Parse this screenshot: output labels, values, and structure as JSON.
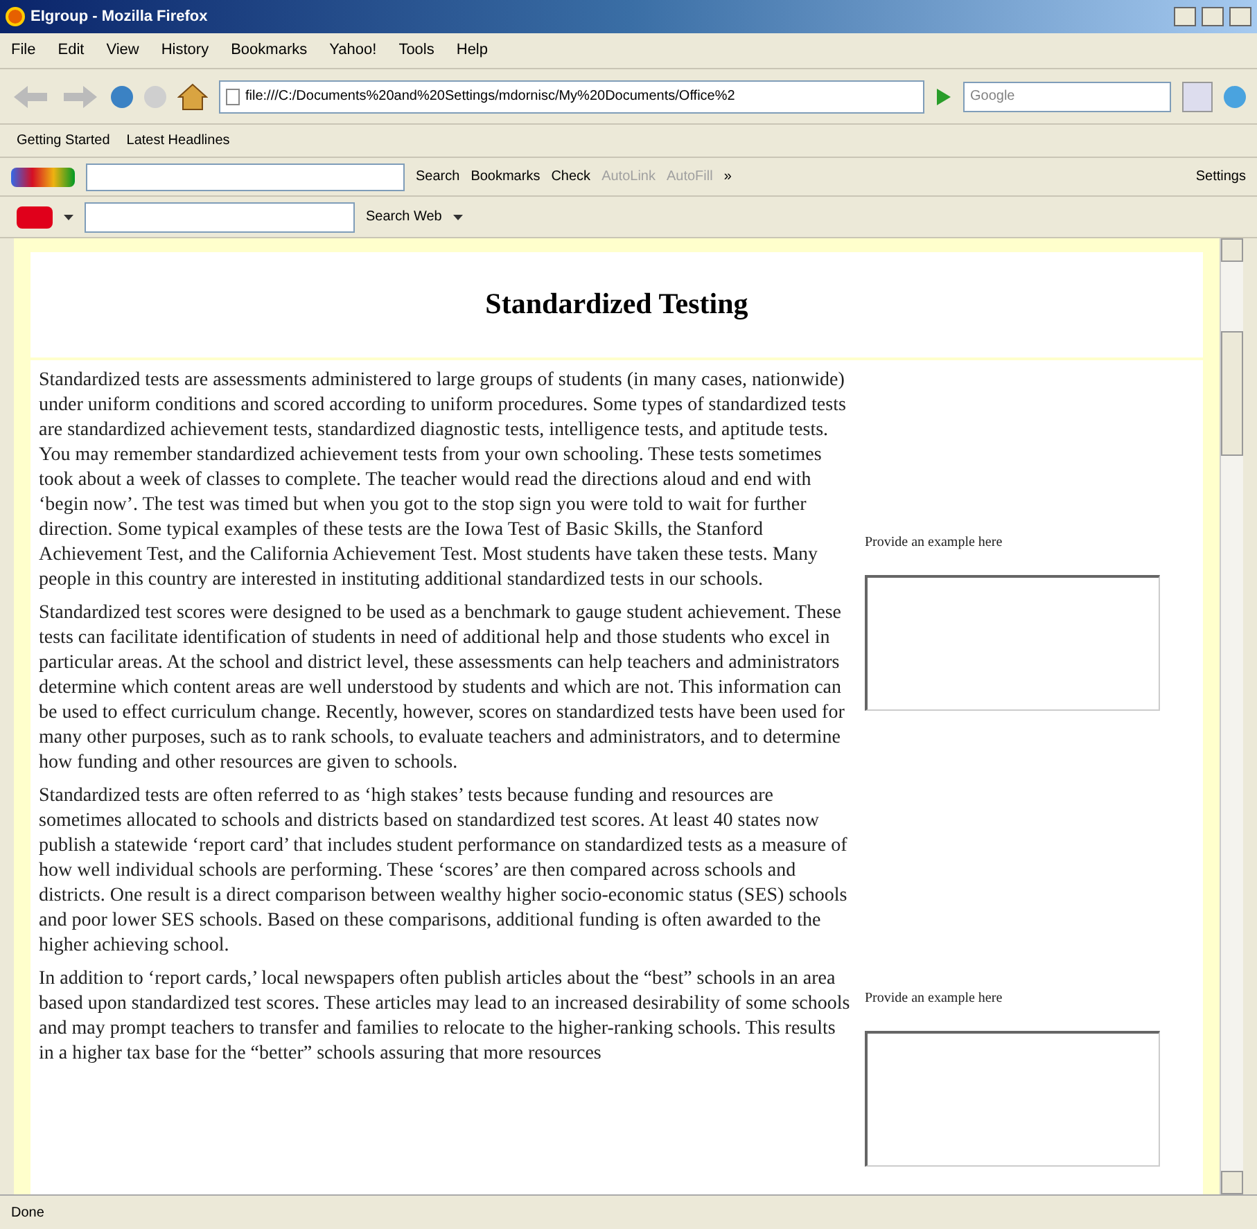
{
  "window": {
    "title": "EIgroup - Mozilla Firefox"
  },
  "menu": [
    "File",
    "Edit",
    "View",
    "History",
    "Bookmarks",
    "Yahoo!",
    "Tools",
    "Help"
  ],
  "navigation": {
    "url": "file:///C:/Documents%20and%20Settings/mdornisc/My%20Documents/Office%2",
    "search_placeholder": "Google"
  },
  "bookmarks_toolbar": [
    "Getting Started",
    "Latest Headlines"
  ],
  "google_toolbar": [
    {
      "label": "Search",
      "disabled": false
    },
    {
      "label": "Bookmarks",
      "disabled": false
    },
    {
      "label": "Check",
      "disabled": false
    },
    {
      "label": "AutoLink",
      "disabled": true
    },
    {
      "label": "AutoFill",
      "disabled": true
    },
    {
      "label": "»",
      "disabled": false
    },
    {
      "label": "Settings",
      "disabled": false
    }
  ],
  "yahoo_toolbar": {
    "search_label": "Search Web"
  },
  "page": {
    "title": "Standardized Testing",
    "paragraphs": [
      "Standardized tests are assessments administered to large groups of students (in many cases, nationwide) under uniform conditions and scored according to uniform procedures.  Some types of standardized tests are standardized achievement tests, standardized diagnostic tests, intelligence tests, and aptitude tests.  You may remember standardized achievement tests from your own schooling.  These tests sometimes took about a week of classes to complete.  The teacher would read the directions aloud and end with ‘begin now’.  The test was timed but when you got to the stop sign you were told to wait for further direction.  Some typical examples of these tests are the Iowa Test of Basic Skills, the Stanford Achievement Test, and the California Achievement Test. Most students have taken these tests.  Many people in this country are interested in instituting additional standardized tests in our schools.",
      "Standardized test scores were designed to be used as a benchmark to gauge student achievement. These tests can facilitate identification of students in need of additional help and those students who excel in particular areas.  At the school and district level, these assessments can help teachers and administrators determine which content areas are well understood by students and which are not.  This information can be used to effect curriculum change.  Recently, however, scores on standardized tests have been used for many other purposes, such as to rank schools, to evaluate teachers and administrators, and to determine how funding and other resources are given to schools.",
      "Standardized tests are often referred to as ‘high stakes’ tests because funding and resources are sometimes allocated to schools and districts based on standardized test scores. At least 40 states now publish a statewide ‘report card’ that includes student performance on standardized tests as a measure of how well individual schools are performing.  These ‘scores’ are then compared across schools and districts.  One result is a direct comparison between wealthy higher socio-economic status (SES) schools and poor lower SES schools. Based on these comparisons, additional funding is often awarded to the higher achieving school.",
      "In addition to ‘report cards,’ local newspapers often publish articles about the “best” schools in an area based upon standardized test scores. These articles may lead to an increased desirability of some schools and may prompt teachers to transfer and families to relocate to the higher-ranking schools. This results in a higher tax base for the “better” schools assuring that more resources"
    ],
    "examples": [
      {
        "label": "Provide an example here"
      },
      {
        "label": "Provide an example here"
      }
    ]
  },
  "status_bar": "Done"
}
